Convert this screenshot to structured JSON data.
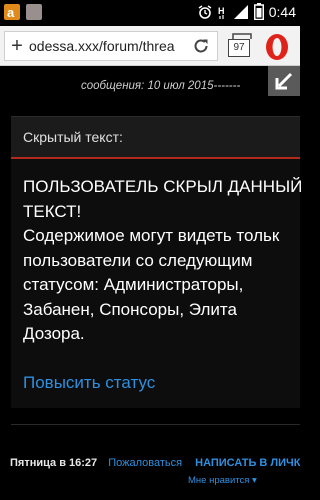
{
  "status_bar": {
    "time": "0:44",
    "network_label": "H"
  },
  "browser": {
    "url": "odessa.xxx/forum/threa",
    "tab_count": "97"
  },
  "post": {
    "meta": "сообщения: 10 июл 2015-------"
  },
  "hidden_block": {
    "title": "Скрытый текст:",
    "message": "ПОЛЬЗОВАТЕЛЬ СКРЫЛ ДАННЫЙ\nТЕКСТ!\nСодержимое могут видеть тольк\nпользователи со следующим\nстатусом: Администраторы,\nЗабанен, Спонсоры, Элита\nДозора.",
    "action_link": "Повысить статус"
  },
  "footer": {
    "date": "Пятница в 16:27",
    "report_link": "Пожаловаться",
    "write_link": "НАПИСАТЬ В ЛИЧК",
    "likes_label": "Мне нравится ▾"
  },
  "colors": {
    "accent_link": "#2f8fe0",
    "header_underline": "#b22a1e",
    "opera_red": "#e0231a"
  }
}
